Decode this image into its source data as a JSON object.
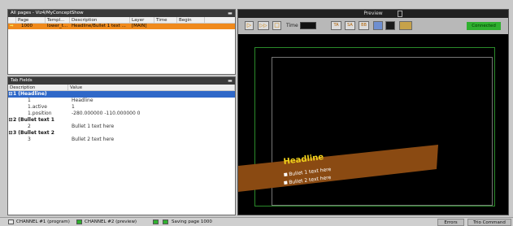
{
  "pages_panel": {
    "title": "All pages - Viz4/MyConceptShow",
    "collapse_glyph": "▬",
    "columns": [
      "",
      "Page",
      "Templ...",
      "Description",
      "Layer",
      "Time",
      "Begin"
    ],
    "rows": [
      {
        "mark": "➡",
        "page": "1000",
        "template": "lower_t...",
        "description": "Headline/Bullet 1 text ...",
        "layer": "[MAIN]",
        "time": "",
        "begin": ""
      }
    ]
  },
  "fields_panel": {
    "title": "Tab Fields",
    "collapse_glyph": "▬",
    "columns": [
      "Description",
      "Value"
    ],
    "groups": [
      {
        "toggle": "⊟",
        "label": "1 (Headline)",
        "children": [
          {
            "desc": "1",
            "val": "Headline"
          },
          {
            "desc": "1.active",
            "val": "1"
          },
          {
            "desc": "1.position",
            "val": "-280.000000 -110.000000 0"
          }
        ]
      },
      {
        "toggle": "⊟",
        "label": "2 (Bullet text 1",
        "children": [
          {
            "desc": "2",
            "val": "Bullet 1 text here"
          }
        ]
      },
      {
        "toggle": "⊟",
        "label": "3 (Bullet text 2",
        "children": [
          {
            "desc": "3",
            "val": "Bullet 2 text here"
          }
        ]
      }
    ]
  },
  "preview": {
    "title": "Preview",
    "time_label": "Time",
    "connected_label": "Connected",
    "toolbar": {
      "play": "▷",
      "continue": "▷▷",
      "stop": "□",
      "ta": "TA",
      "sa": "SA",
      "bb": "BB"
    },
    "graphic": {
      "headline": "Headline",
      "bullet1": "Bullet 1 text here",
      "bullet2": "Bullet 2 text here"
    },
    "colors": {
      "headline": "#f2d21b",
      "lower_third": "#8a4a12",
      "safe_area": "#2a8a2a",
      "connected": "#2fb02f"
    }
  },
  "statusbar": {
    "channel1": "CHANNEL #1 (program)",
    "channel2": "CHANNEL #2 (preview)",
    "saving": "Saving page 1000",
    "errors": "Errors",
    "trio": "Trio Command"
  }
}
